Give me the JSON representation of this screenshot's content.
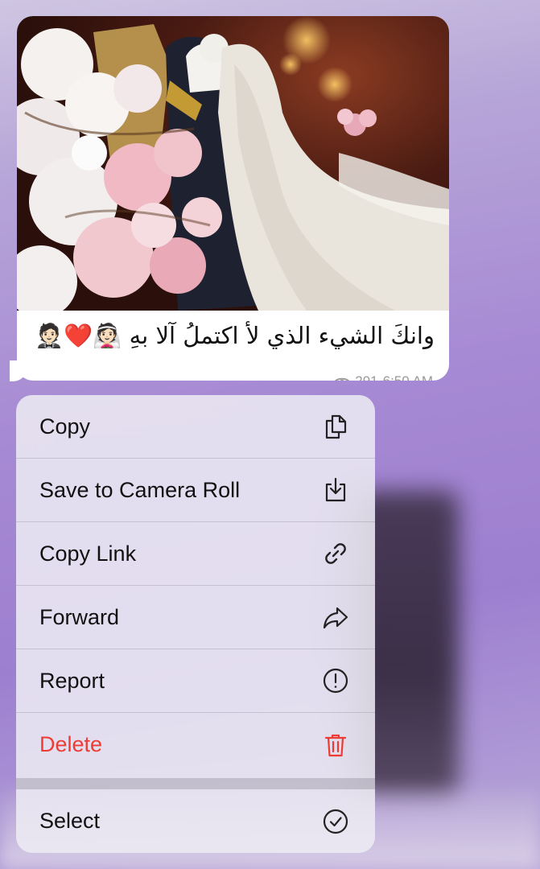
{
  "message": {
    "caption": "وانكَ الشيء الذي لأ اكتملُ آلا بهِ 👰🏻❤️🤵🏻",
    "views": "291",
    "time": "6:50 AM"
  },
  "menu": {
    "items": [
      {
        "label": "Copy",
        "icon": "copy-icon"
      },
      {
        "label": "Save to Camera Roll",
        "icon": "save-download-icon"
      },
      {
        "label": "Copy Link",
        "icon": "link-icon"
      },
      {
        "label": "Forward",
        "icon": "forward-arrow-icon"
      },
      {
        "label": "Report",
        "icon": "exclamation-circle-icon"
      },
      {
        "label": "Delete",
        "icon": "trash-icon",
        "color": "#ee3b33"
      },
      {
        "label": "Select",
        "icon": "checkmark-circle-icon"
      }
    ]
  }
}
